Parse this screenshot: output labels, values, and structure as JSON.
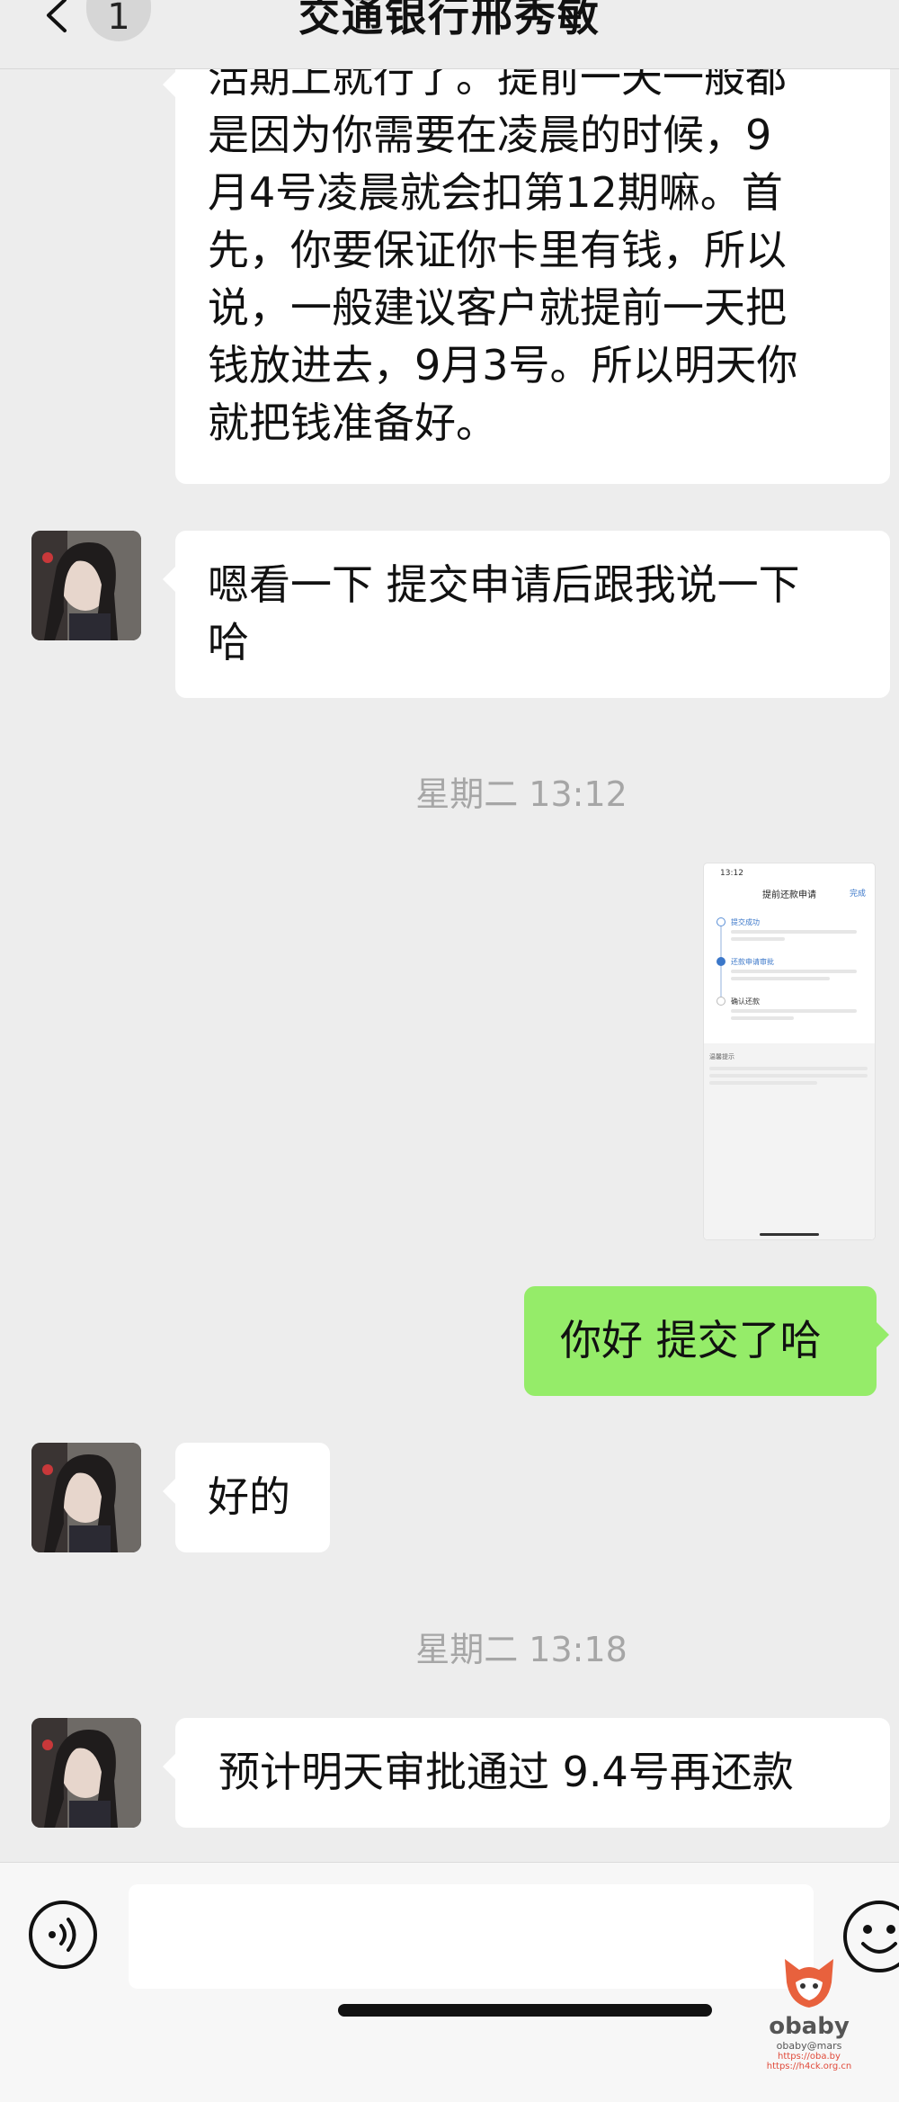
{
  "header": {
    "title": "交通银行邢秀敏",
    "unread_count": "1"
  },
  "messages": [
    {
      "sender": "contact",
      "text": "活期上就行了。提前一天一般都是因为你需要在凌晨的时候，9月4号凌晨就会扣第12期嘛。首先，你要保证你卡里有钱，所以说，一般建议客户就提前一天把钱放进去，9月3号。所以明天你就把钱准备好。",
      "lines": [
        "活期上就行了。提前一天一般都",
        "是因为你需要在凌晨的时候，9",
        "月4号凌晨就会扣第12期嘛。首",
        "先，你要保证你卡里有钱，所以",
        "说，一般建议客户就提前一天把",
        "钱放进去，9月3号。所以明天你",
        "就把钱准备好。"
      ]
    },
    {
      "sender": "contact",
      "lines": [
        "嗯看一下 提交申请后跟我说一下",
        "哈"
      ]
    },
    {
      "type": "timestamp",
      "text": "星期二 13:12"
    },
    {
      "sender": "me",
      "type": "image",
      "image": {
        "status_time": "13:12",
        "title": "提前还款申请",
        "done": "完成",
        "steps": [
          "提交成功",
          "还款申请审批",
          "确认还款"
        ],
        "tips_label": "温馨提示"
      }
    },
    {
      "sender": "me",
      "text": "你好 提交了哈"
    },
    {
      "sender": "contact",
      "text": "好的"
    },
    {
      "type": "timestamp",
      "text": "星期二 13:18"
    },
    {
      "sender": "contact",
      "text": "预计明天审批通过 9.4号再还款"
    }
  ],
  "input_bar": {
    "value": "",
    "voice_icon": "voice-icon",
    "emoji_icon": "emoji-icon"
  },
  "watermark": {
    "brand": "obaby",
    "sub": "obaby@mars",
    "url1": "https://oba.by",
    "url2": "https://h4ck.org.cn"
  },
  "colors": {
    "background": "#ededed",
    "bubble_incoming": "#ffffff",
    "bubble_outgoing": "#95ec69",
    "timestamp": "#a6a6a6"
  }
}
